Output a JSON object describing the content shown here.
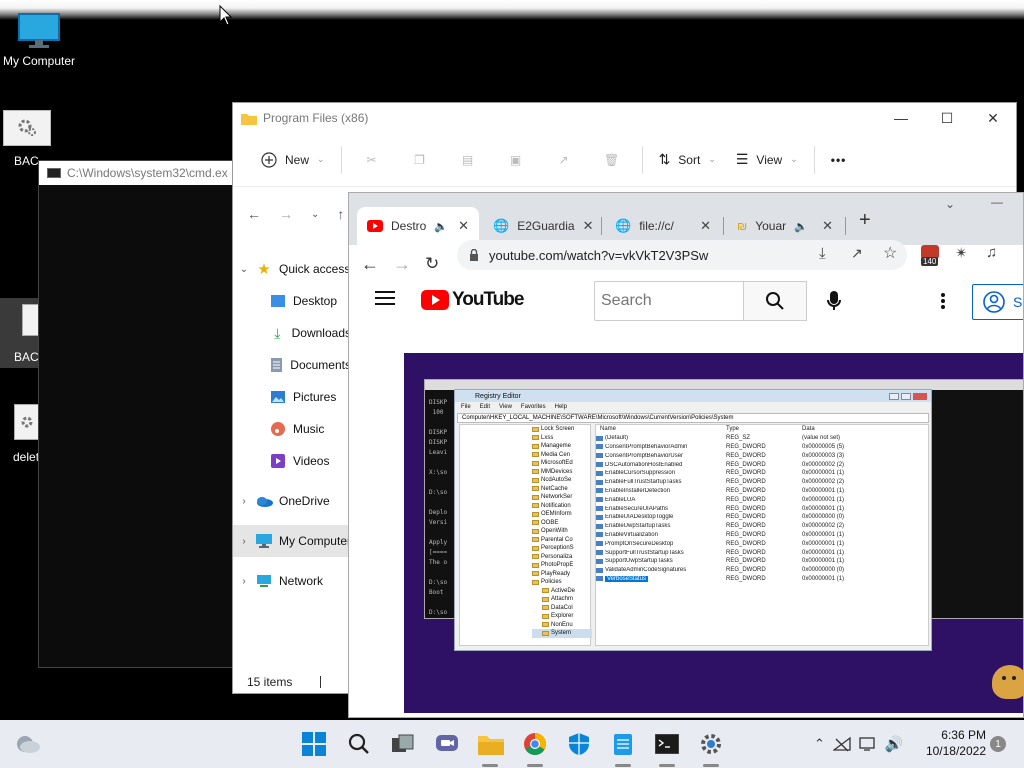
{
  "desktop": {
    "icons": [
      {
        "label": "My Computer"
      },
      {
        "label": "BAC"
      },
      {
        "label": "BAC"
      },
      {
        "label": "delet"
      }
    ]
  },
  "cmd": {
    "title": "C:\\Windows\\system32\\cmd.ex"
  },
  "explorer": {
    "title": "Program Files (x86)",
    "toolbar": {
      "new_label": "New",
      "sort_label": "Sort",
      "view_label": "View",
      "more_label": "•••"
    },
    "nav_items": [
      {
        "label": "Quick access",
        "icon": "star-icon",
        "chevron": "⌄"
      },
      {
        "label": "Desktop",
        "icon": "desktop-folder-icon"
      },
      {
        "label": "Downloads",
        "icon": "download-icon"
      },
      {
        "label": "Documents",
        "icon": "documents-icon"
      },
      {
        "label": "Pictures",
        "icon": "pictures-icon"
      },
      {
        "label": "Music",
        "icon": "music-icon"
      },
      {
        "label": "Videos",
        "icon": "videos-icon"
      },
      {
        "label": "OneDrive",
        "icon": "onedrive-icon",
        "chevron": "›"
      },
      {
        "label": "My Computer",
        "icon": "computer-icon",
        "chevron": "›"
      },
      {
        "label": "Network",
        "icon": "network-icon",
        "chevron": "›"
      }
    ],
    "status": "15 items"
  },
  "chrome": {
    "tabs": [
      {
        "label": "Destro",
        "icon": "youtube-favicon"
      },
      {
        "label": "E2Guardia",
        "icon": "globe-icon"
      },
      {
        "label": "file://c/",
        "icon": "globe-icon"
      },
      {
        "label": "Youar",
        "icon": "bookmark-favicon"
      }
    ],
    "url": "youtube.com/watch?v=vkVkT2V3PSw",
    "extension_badge": "140"
  },
  "youtube": {
    "logo_text": "YouTube",
    "search_placeholder": "Search",
    "signin_label": "S"
  },
  "regedit": {
    "title": "Registry Editor",
    "menu": [
      "File",
      "Edit",
      "View",
      "Favorites",
      "Help"
    ],
    "path": "Computer\\HKEY_LOCAL_MACHINE\\SOFTWARE\\Microsoft\\Windows\\CurrentVersion\\Policies\\System",
    "tree": [
      "Lock Screen",
      "Lxss",
      "Manageme",
      "Media Cen",
      "MicrosoftEd",
      "MMDevices",
      "NcdAutoSe",
      "NetCache",
      "NetworkSer",
      "Notification",
      "OEMInform",
      "OOBE",
      "OpenWith",
      "Parental Co",
      "PerceptionS",
      "Personaliza",
      "PhotoPropE",
      "PlayReady",
      "Policies",
      "ActiveDe",
      "Attachm",
      "DataCol",
      "Explorer",
      "NonEnu",
      "System"
    ],
    "columns": {
      "name": "Name",
      "type": "Type",
      "data": "Data"
    },
    "values": [
      {
        "name": "(Default)",
        "type": "REG_SZ",
        "data": "(value not set)"
      },
      {
        "name": "ConsentPromptBehaviorAdmin",
        "type": "REG_DWORD",
        "data": "0x00000005 (5)"
      },
      {
        "name": "ConsentPromptBehaviorUser",
        "type": "REG_DWORD",
        "data": "0x00000003 (3)"
      },
      {
        "name": "DSCAutomationHostEnabled",
        "type": "REG_DWORD",
        "data": "0x00000002 (2)"
      },
      {
        "name": "EnableCursorSuppression",
        "type": "REG_DWORD",
        "data": "0x00000001 (1)"
      },
      {
        "name": "EnableFullTrustStartupTasks",
        "type": "REG_DWORD",
        "data": "0x00000002 (2)"
      },
      {
        "name": "EnableInstallerDetection",
        "type": "REG_DWORD",
        "data": "0x00000001 (1)"
      },
      {
        "name": "EnableLUA",
        "type": "REG_DWORD",
        "data": "0x00000001 (1)"
      },
      {
        "name": "EnableSecureUIAPaths",
        "type": "REG_DWORD",
        "data": "0x00000001 (1)"
      },
      {
        "name": "EnableUIADesktopToggle",
        "type": "REG_DWORD",
        "data": "0x00000000 (0)"
      },
      {
        "name": "EnableUwpStartupTasks",
        "type": "REG_DWORD",
        "data": "0x00000002 (2)"
      },
      {
        "name": "EnableVirtualization",
        "type": "REG_DWORD",
        "data": "0x00000001 (1)"
      },
      {
        "name": "PromptOnSecureDesktop",
        "type": "REG_DWORD",
        "data": "0x00000001 (1)"
      },
      {
        "name": "SupportFullTrustStartupTasks",
        "type": "REG_DWORD",
        "data": "0x00000001 (1)"
      },
      {
        "name": "SupportUwpStartupTasks",
        "type": "REG_DWORD",
        "data": "0x00000001 (1)"
      },
      {
        "name": "ValidateAdminCodeSignatures",
        "type": "REG_DWORD",
        "data": "0x00000000 (0)"
      },
      {
        "name": "VerboseStatus",
        "type": "REG_DWORD",
        "data": "0x00000001 (1)"
      }
    ]
  },
  "taskbar": {
    "time": "6:36 PM",
    "date": "10/18/2022",
    "notification_count": "1"
  }
}
